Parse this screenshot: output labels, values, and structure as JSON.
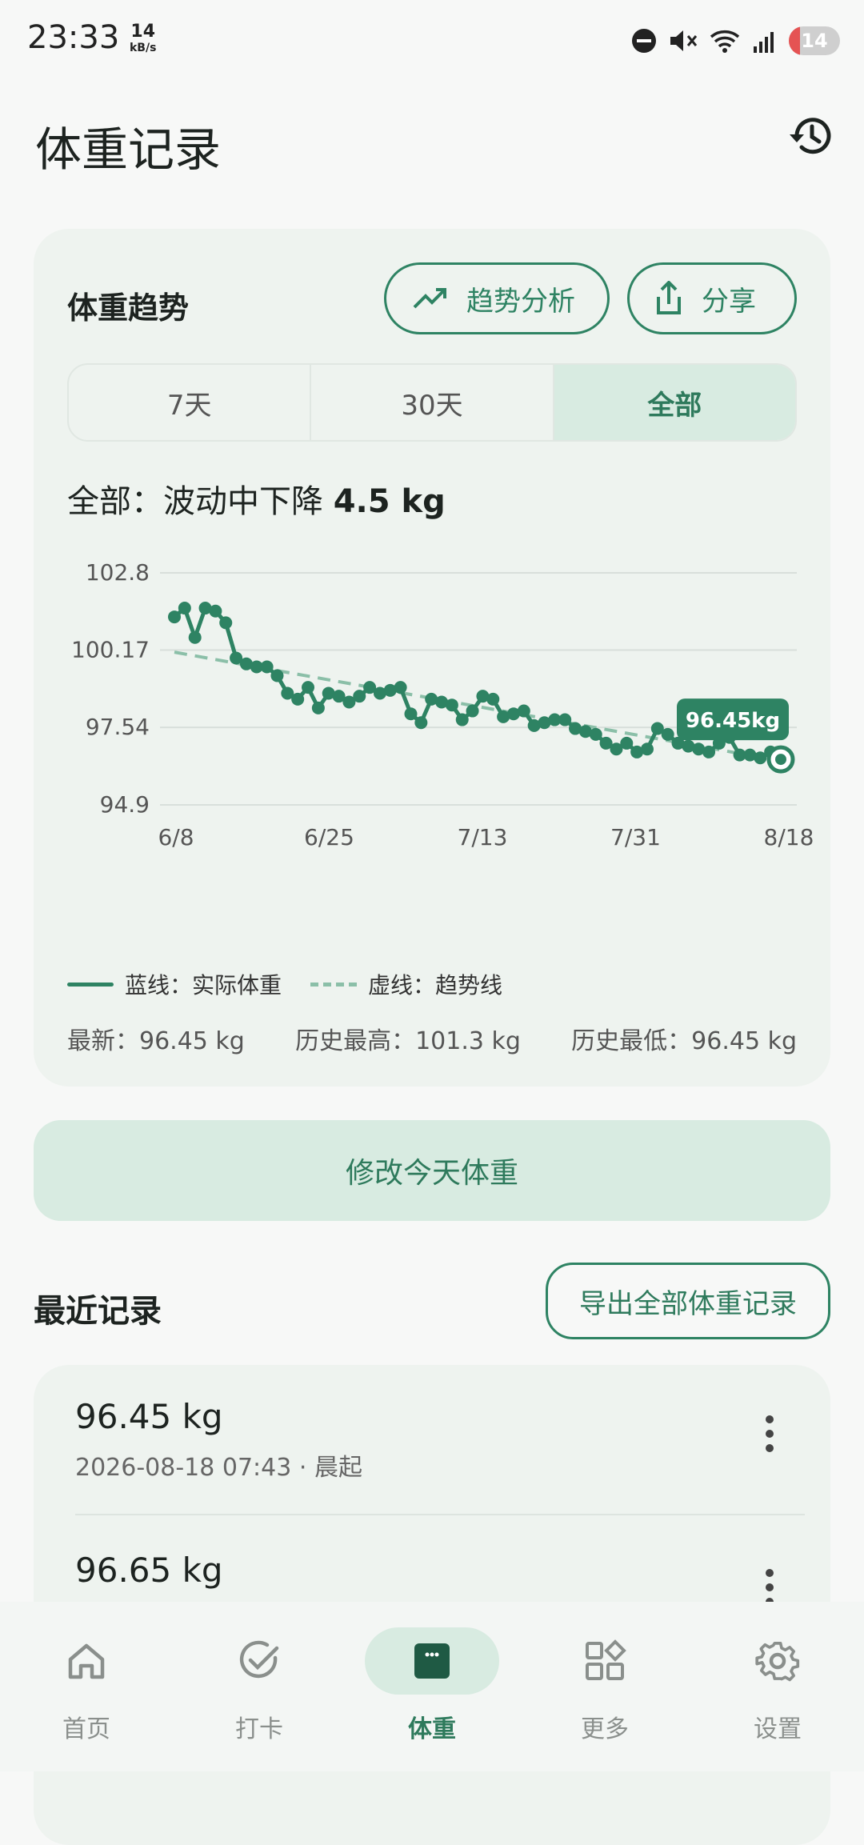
{
  "status": {
    "time": "23:33",
    "speed_value": "14",
    "speed_unit": "kB/s",
    "battery": "14"
  },
  "page": {
    "title": "体重记录"
  },
  "trend_card": {
    "title": "体重趋势",
    "trend_button": "趋势分析",
    "share_button": "分享",
    "ranges": [
      "7天",
      "30天",
      "全部"
    ],
    "selected_range": "全部",
    "summary_prefix": "全部：波动中下降",
    "summary_value": "4.5 kg",
    "legend_actual": "蓝线：实际体重",
    "legend_trend": "虚线：趋势线",
    "stat_latest": "最新：96.45 kg",
    "stat_max": "历史最高：101.3 kg",
    "stat_min": "历史最低：96.45 kg"
  },
  "chart_data": {
    "type": "line",
    "y_ticks": [
      "102.8",
      "100.17",
      "97.54",
      "94.9"
    ],
    "ylim": [
      94.9,
      102.8
    ],
    "x_ticks": [
      "6/8",
      "6/25",
      "7/13",
      "7/31",
      "8/18"
    ],
    "callout": "96.45kg",
    "series": [
      {
        "name": "实际体重",
        "color": "#2e8363",
        "values": [
          101.3,
          101.6,
          100.6,
          101.6,
          101.5,
          101.1,
          99.9,
          99.7,
          99.6,
          99.6,
          99.3,
          98.7,
          98.5,
          98.9,
          98.2,
          98.7,
          98.6,
          98.4,
          98.6,
          98.9,
          98.7,
          98.8,
          98.9,
          98.0,
          97.7,
          98.5,
          98.4,
          98.3,
          97.8,
          98.1,
          98.6,
          98.5,
          97.9,
          98.0,
          98.1,
          97.6,
          97.7,
          97.8,
          97.8,
          97.5,
          97.4,
          97.3,
          97.0,
          96.8,
          97.0,
          96.7,
          96.8,
          97.5,
          97.3,
          97.0,
          96.9,
          96.8,
          96.7,
          97.0,
          97.2,
          96.6,
          96.6,
          96.5,
          96.7,
          96.45
        ]
      },
      {
        "name": "趋势线",
        "color": "#8bbfa8",
        "values": [
          100.1,
          96.4
        ]
      }
    ]
  },
  "recent": {
    "title": "最近记录",
    "export_button": "导出全部体重记录",
    "items": [
      {
        "weight": "96.45 kg",
        "datetime": "2026-08-18 07:43 · 晨起"
      },
      {
        "weight": "96.65 kg",
        "datetime": ""
      }
    ]
  },
  "edit_button": "修改今天体重",
  "nav": [
    {
      "label": "首页",
      "icon": "home-icon"
    },
    {
      "label": "打卡",
      "icon": "check-circle-icon"
    },
    {
      "label": "体重",
      "icon": "scale-icon"
    },
    {
      "label": "更多",
      "icon": "apps-icon"
    },
    {
      "label": "设置",
      "icon": "gear-icon"
    }
  ]
}
